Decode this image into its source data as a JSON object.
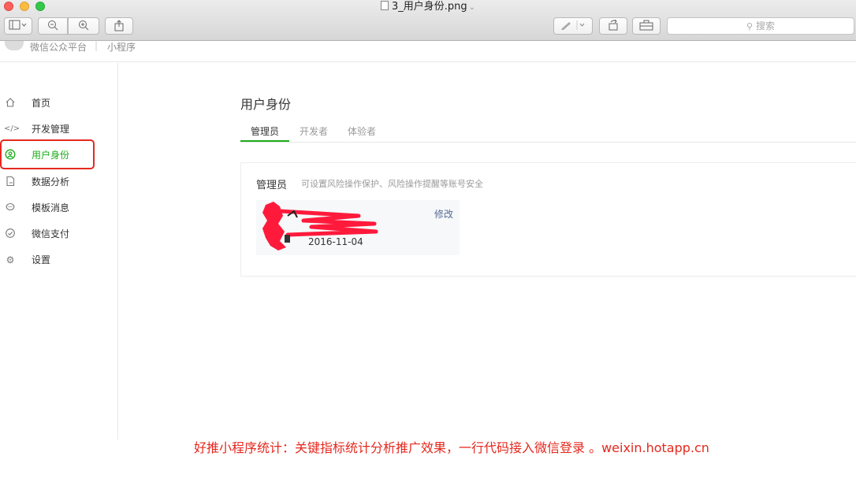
{
  "window": {
    "file_name": "3_用户身份.png",
    "search_placeholder": "搜索"
  },
  "header": {
    "brand": "微信公众平台",
    "separator": "|",
    "product": "小程序"
  },
  "sidebar": {
    "items": [
      {
        "label": "首页",
        "icon": "home-icon",
        "active": false
      },
      {
        "label": "开发管理",
        "icon": "code-icon",
        "active": false
      },
      {
        "label": "用户身份",
        "icon": "user-circle-icon",
        "active": true
      },
      {
        "label": "数据分析",
        "icon": "document-chart-icon",
        "active": false
      },
      {
        "label": "模板消息",
        "icon": "message-bubble-icon",
        "active": false
      },
      {
        "label": "微信支付",
        "icon": "payment-icon",
        "active": false
      },
      {
        "label": "设置",
        "icon": "gear-icon",
        "active": false
      }
    ]
  },
  "main": {
    "title": "用户身份",
    "tabs": [
      "管理员",
      "开发者",
      "体验者"
    ],
    "active_tab": "管理员",
    "card": {
      "title": "管理员",
      "description": "可设置风险操作保护、风险操作提醒等账号安全",
      "edit_label": "修改",
      "date": "2016-11-04"
    }
  },
  "promo_text": "好推小程序统计：关键指标统计分析推广效果，一行代码接入微信登录 。weixin.hotapp.cn",
  "colors": {
    "accent_green": "#1aad19",
    "highlight_red": "#e5281e",
    "link_blue": "#576b95"
  }
}
